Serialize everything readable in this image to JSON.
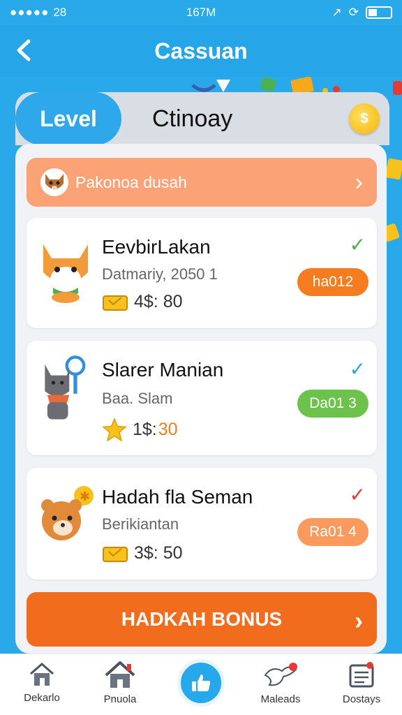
{
  "status_bar": {
    "signal_text": "28",
    "time": "167M"
  },
  "header": {
    "title": "Cassuan",
    "back_icon": "chevron-left-icon"
  },
  "tabs": {
    "active": "Level",
    "other": "Ctinoay",
    "coin_icon": "coin-icon"
  },
  "promo": {
    "text": "Pakonoa dusah",
    "icon": "fox-avatar-icon"
  },
  "cards": [
    {
      "title": "EevbirLakan",
      "subtitle": "Datmariy, 2050   1",
      "price": "4$: 80",
      "price_icon": "ticket-icon",
      "check_color": "#4caf50",
      "pill_text": "ha012",
      "pill_color": "#f57c1f",
      "avatar": "fox-icon"
    },
    {
      "title": "Slarer Manian",
      "subtitle": "Baa. Slam",
      "price_prefix": "1$:",
      "price_suffix": "30",
      "price_icon": "star-icon",
      "check_color": "#29a7e0",
      "pill_text": "Da01 3",
      "pill_color": "#6cc24a",
      "avatar": "cat-icon"
    },
    {
      "title": "Hadah fla Seman",
      "subtitle": "Berikiantan",
      "price": "3$: 50",
      "price_icon": "ticket-icon",
      "check_color": "#e53935",
      "pill_text": "Ra01 4",
      "pill_color": "#fb9a5f",
      "avatar": "bear-icon"
    }
  ],
  "bonus_button": {
    "label": "HADKAH BONUS"
  },
  "bottom_nav": [
    {
      "label": "Dekarlo",
      "icon": "home-icon"
    },
    {
      "label": "Pnuola",
      "icon": "house-icon"
    },
    {
      "label": "",
      "icon": "thumbs-up-icon"
    },
    {
      "label": "Maleads",
      "icon": "bird-icon"
    },
    {
      "label": "Dostays",
      "icon": "calendar-icon"
    }
  ]
}
